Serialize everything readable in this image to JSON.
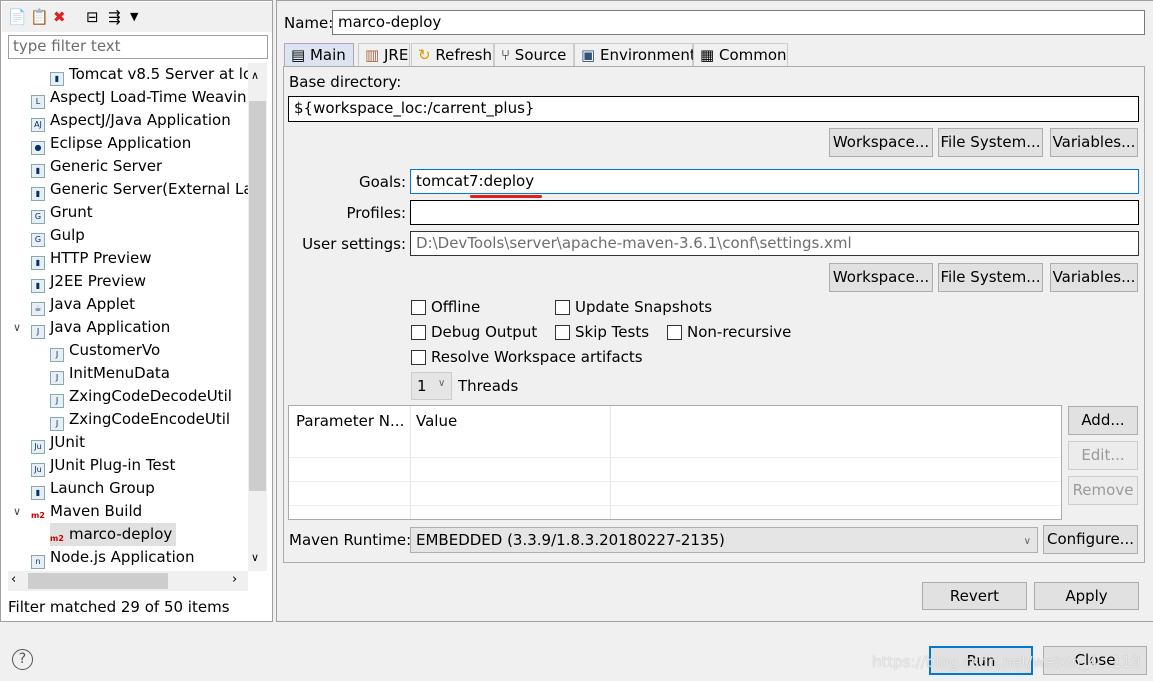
{
  "sidebar": {
    "filter_placeholder": "type filter text",
    "items": [
      {
        "label": "Tomcat v8.5 Server at lo",
        "icon": "server-icon"
      },
      {
        "label": "AspectJ Load-Time Weavin",
        "icon": "ltw-icon"
      },
      {
        "label": "AspectJ/Java Application",
        "icon": "aj-icon"
      },
      {
        "label": "Eclipse Application",
        "icon": "eclipse-icon"
      },
      {
        "label": "Generic Server",
        "icon": "server-icon"
      },
      {
        "label": "Generic Server(External Lau",
        "icon": "server-icon"
      },
      {
        "label": "Grunt",
        "icon": "grunt-icon"
      },
      {
        "label": "Gulp",
        "icon": "gulp-icon"
      },
      {
        "label": "HTTP Preview",
        "icon": "server-icon"
      },
      {
        "label": "J2EE Preview",
        "icon": "server-icon"
      },
      {
        "label": "Java Applet",
        "icon": "applet-icon"
      },
      {
        "label": "Java Application",
        "icon": "java-app-icon"
      },
      {
        "label": "CustomerVo",
        "icon": "java-class-icon"
      },
      {
        "label": "InitMenuData",
        "icon": "java-class-icon"
      },
      {
        "label": "ZxingCodeDecodeUtil",
        "icon": "java-class-icon"
      },
      {
        "label": "ZxingCodeEncodeUtil",
        "icon": "java-class-icon"
      },
      {
        "label": "JUnit",
        "icon": "junit-icon"
      },
      {
        "label": "JUnit Plug-in Test",
        "icon": "junit-plugin-icon"
      },
      {
        "label": "Launch Group",
        "icon": "launch-group-icon"
      },
      {
        "label": "Maven Build",
        "icon": "m2-icon"
      },
      {
        "label": "marco-deploy",
        "icon": "m2-icon"
      },
      {
        "label": "Node.js Application",
        "icon": "nodejs-icon"
      }
    ],
    "status": "Filter matched 29 of 50 items"
  },
  "main": {
    "name_label": "Name:",
    "name_value": "marco-deploy",
    "tabs": [
      {
        "label": "Main"
      },
      {
        "label": "JRE"
      },
      {
        "label": "Refresh"
      },
      {
        "label": "Source"
      },
      {
        "label": "Environment"
      },
      {
        "label": "Common"
      }
    ],
    "base_dir_label": "Base directory:",
    "base_dir_value": "${workspace_loc:/carrent_plus}",
    "workspace_btn": "Workspace...",
    "filesystem_btn": "File System...",
    "variables_btn": "Variables...",
    "goals_label": "Goals:",
    "goals_value": "tomcat7:deploy",
    "profiles_label": "Profiles:",
    "profiles_value": "",
    "user_settings_label": "User settings:",
    "user_settings_value": "D:\\DevTools\\server\\apache-maven-3.6.1\\conf\\settings.xml",
    "checkboxes": {
      "offline": "Offline",
      "update_snapshots": "Update Snapshots",
      "debug_output": "Debug Output",
      "skip_tests": "Skip Tests",
      "non_recursive": "Non-recursive",
      "resolve_workspace": "Resolve Workspace artifacts"
    },
    "threads_value": "1",
    "threads_label": "Threads",
    "param_col_name": "Parameter N...",
    "param_col_value": "Value",
    "add_btn": "Add...",
    "edit_btn": "Edit...",
    "remove_btn": "Remove",
    "runtime_label": "Maven Runtime:",
    "runtime_value": "EMBEDDED (3.3.9/1.8.3.20180227-2135)",
    "configure_btn": "Configure...",
    "revert_btn": "Revert",
    "apply_btn": "Apply"
  },
  "footer": {
    "run_btn": "Run",
    "close_btn": "Close",
    "watermark": "https://blog.csdn.net/weixin_4...119"
  },
  "colors": {
    "accent": "#0078d7",
    "annotation": "#e0201a"
  }
}
